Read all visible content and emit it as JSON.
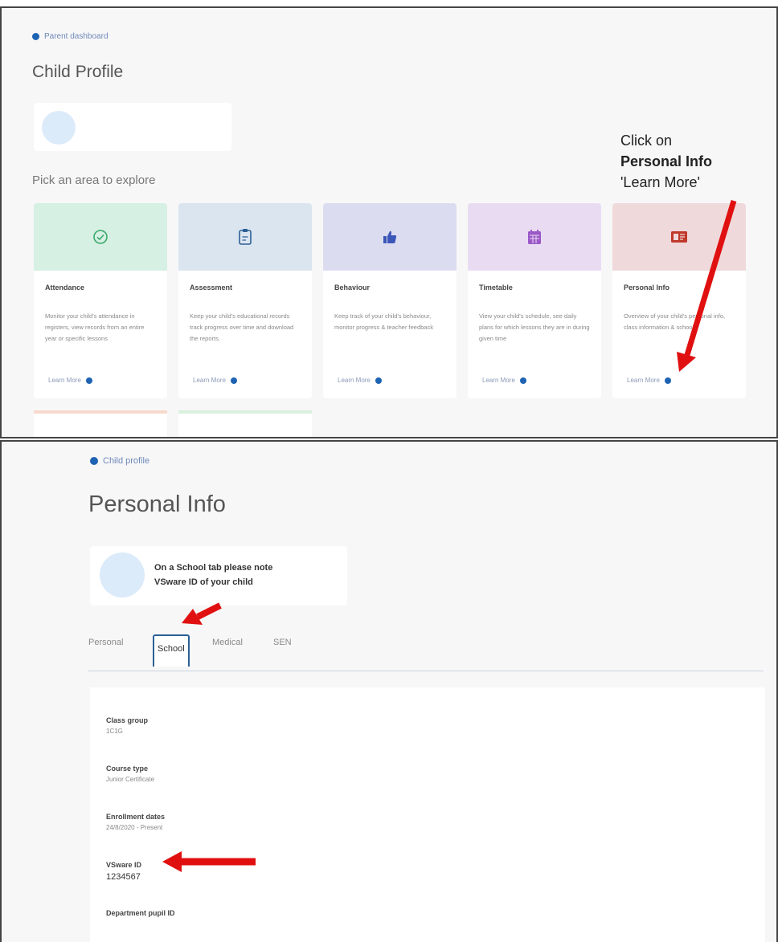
{
  "top": {
    "breadcrumb": "Parent dashboard",
    "title": "Child Profile",
    "section_label": "Pick an area to explore",
    "cards": [
      {
        "title": "Attendance",
        "desc": "Monitor your child's attendance in registers, view records from an entire year or specific lessons",
        "link": "Learn More",
        "color": "#d6f0e3",
        "icon": "check-circle-icon",
        "icon_color": "#3aa86b"
      },
      {
        "title": "Assessment",
        "desc": "Keep your child's educational records track progress over time and download the reports.",
        "link": "Learn More",
        "color": "#dbe5f0",
        "icon": "clipboard-icon",
        "icon_color": "#2c5f96"
      },
      {
        "title": "Behaviour",
        "desc": "Keep track of your child's behaviour, monitor progress & teacher feedback",
        "link": "Learn More",
        "color": "#dcdcf1",
        "icon": "thumbs-up-icon",
        "icon_color": "#3b56b8"
      },
      {
        "title": "Timetable",
        "desc": "View your child's schedule, see daily plans for which lessons they are in during given time",
        "link": "Learn More",
        "color": "#e9dcf2",
        "icon": "calendar-icon",
        "icon_color": "#9b59c8"
      },
      {
        "title": "Personal Info",
        "desc": "Overview of your child's personal info, class information & school",
        "link": "Learn More",
        "color": "#f0d9db",
        "icon": "id-card-icon",
        "icon_color": "#c0392b"
      }
    ],
    "stubs": [
      {
        "color": "#f7d9cc"
      },
      {
        "color": "#d8f0dc"
      }
    ],
    "callout": {
      "line1": "Click on",
      "line2": "Personal Info",
      "line3": "'Learn More'"
    }
  },
  "bottom": {
    "breadcrumb": "Child profile",
    "title": "Personal Info",
    "hint": {
      "pre": "On a ",
      "bold": "School",
      "post": " tab please note",
      "line2": "VSware ID of your child"
    },
    "tabs": [
      "Personal",
      "School",
      "Medical",
      "SEN"
    ],
    "active_tab": "School",
    "fields": [
      {
        "label": "Class group",
        "value": "1C1G"
      },
      {
        "label": "Course type",
        "value": "Junior Certificate"
      },
      {
        "label": "Enrollment dates",
        "value": "24/8/2020 - Present"
      },
      {
        "label": "VSware ID",
        "value": "1234567"
      },
      {
        "label": "Department pupil ID",
        "value": ""
      }
    ]
  },
  "colors": {
    "arrow": "#e01010",
    "link_dot": "#1e63b3",
    "tab_active_border": "#2c5f96"
  }
}
